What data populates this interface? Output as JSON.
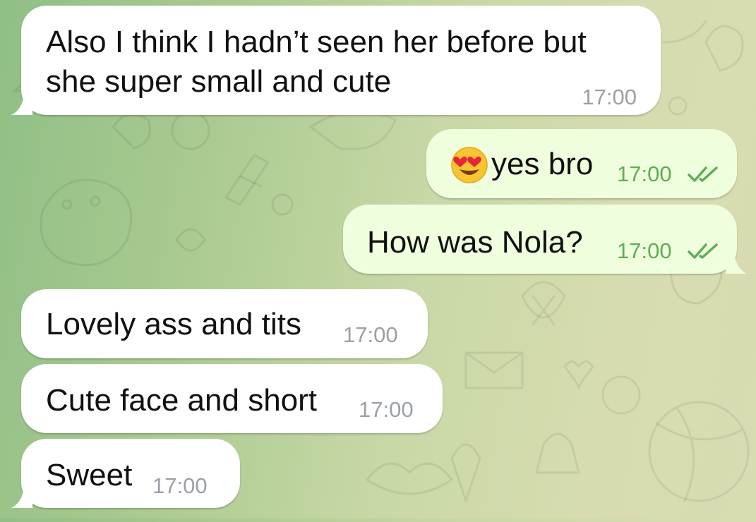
{
  "chat": {
    "messages": [
      {
        "id": "m1",
        "direction": "incoming",
        "lines": [
          "Also I think I hadn’t seen her before but",
          "she super small and cute"
        ],
        "time": "17:00"
      },
      {
        "id": "m2",
        "direction": "outgoing",
        "emoji": "heart-eyes-emoji",
        "text": "yes bro",
        "time": "17:00",
        "status": "read"
      },
      {
        "id": "m3",
        "direction": "outgoing",
        "text": "How was Nola?",
        "time": "17:00",
        "status": "read"
      },
      {
        "id": "m4",
        "direction": "incoming",
        "text": "Lovely ass and tits",
        "time": "17:00"
      },
      {
        "id": "m5",
        "direction": "incoming",
        "text": "Cute face and short",
        "time": "17:00"
      },
      {
        "id": "m6",
        "direction": "incoming",
        "text": "Sweet",
        "time": "17:00"
      }
    ]
  },
  "colors": {
    "incoming_bubble": "#ffffff",
    "outgoing_bubble": "#effedd",
    "incoming_time": "#9aa0a6",
    "outgoing_time": "#5fad56",
    "read_ticks": "#5fad56"
  }
}
